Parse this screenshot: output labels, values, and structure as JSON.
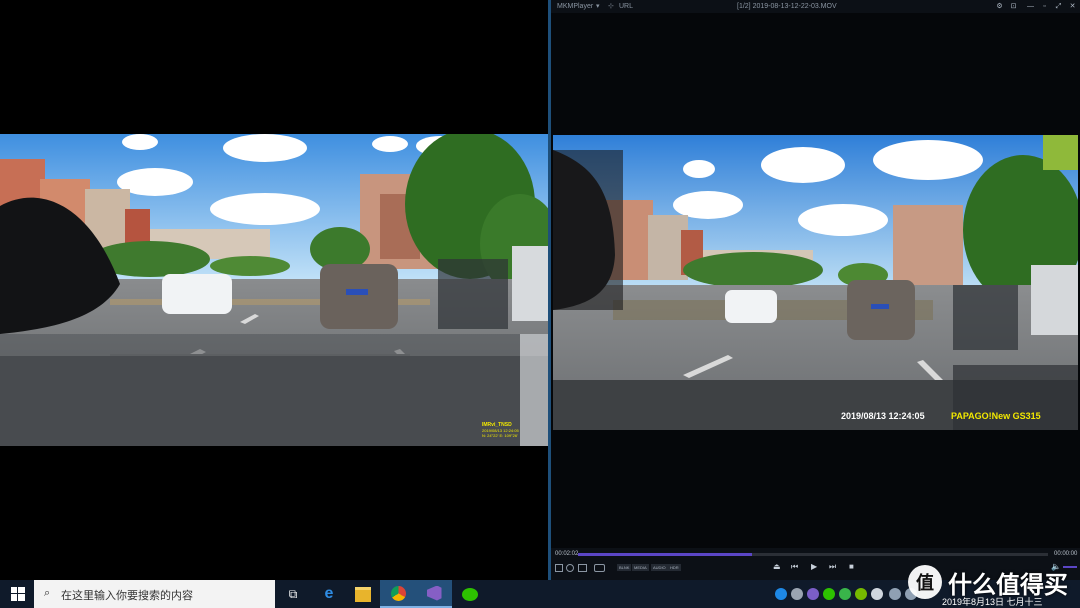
{
  "left_player": {
    "osd_brand": "IMRvi_TNSD",
    "osd_lines": [
      "2019/08/13 12:24:05",
      "N: 24°22'    E: 109°26'"
    ]
  },
  "right_player": {
    "app_name": "MKMPlayer",
    "menu_url": "URL",
    "window_title": "[1/2] 2019-08-13-12-22-03.MOV",
    "osd_timestamp": "2019/08/13 12:24:05",
    "osd_brand": "PAPAGO!New GS315",
    "time_elapsed": "00:02:02",
    "time_total": "00:00:00",
    "progress": 0.37,
    "control_tags": [
      "BLNK",
      "MEDIA",
      "AUDIO",
      "HDR"
    ]
  },
  "taskbar": {
    "search_placeholder": "在这里输入你要搜索的内容",
    "date_text": "2019年8月13日 七月十三"
  },
  "watermark": {
    "text": "什么值得买"
  }
}
